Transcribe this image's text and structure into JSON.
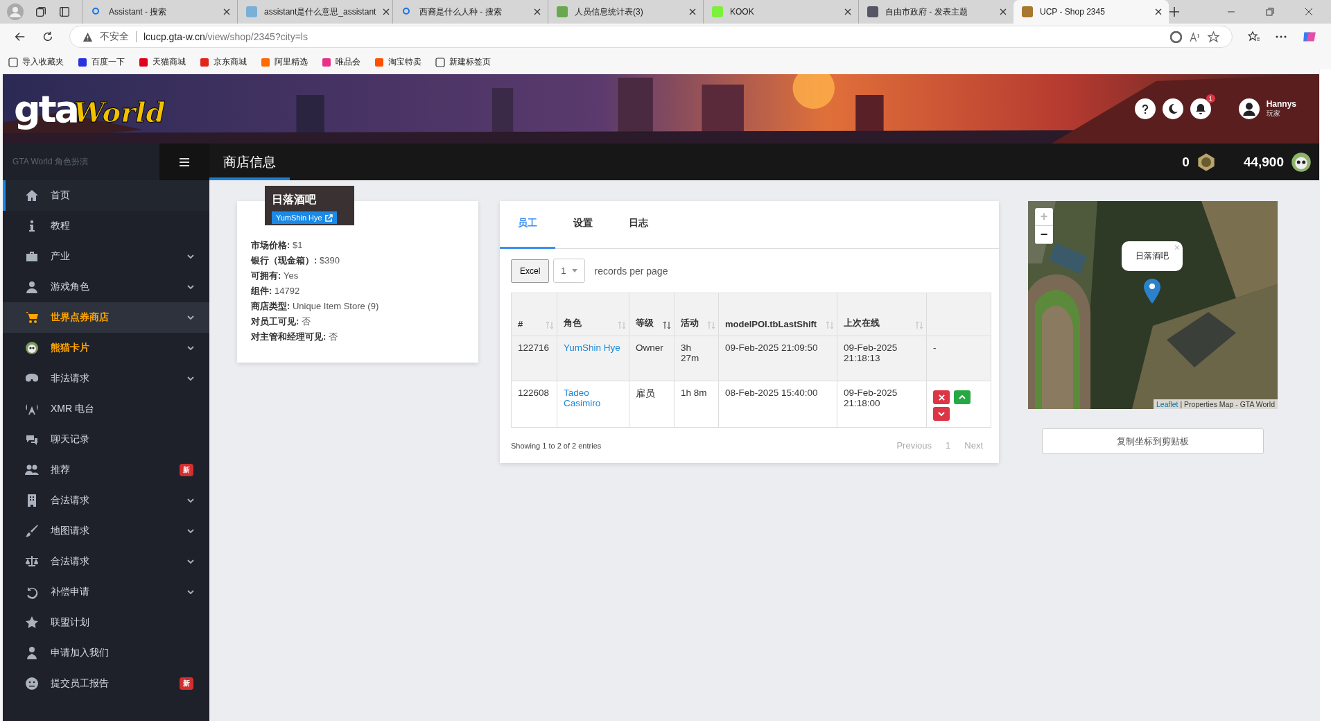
{
  "browser": {
    "tabs": [
      {
        "title": "Assistant - 搜索",
        "kind": "search",
        "selected": false
      },
      {
        "title": "assistant是什么意思_assistant",
        "selected": false
      },
      {
        "title": "西裔是什么人种 - 搜索",
        "kind": "search",
        "selected": false
      },
      {
        "title": "人员信息统计表(3)",
        "kind": "sheet",
        "selected": false
      },
      {
        "title": "KOOK",
        "kind": "kook",
        "selected": false
      },
      {
        "title": "自由市政府 - 发表主题",
        "kind": "seal",
        "selected": false
      },
      {
        "title": "UCP - Shop 2345",
        "kind": "shop",
        "selected": true
      }
    ],
    "address": {
      "warning": "不安全",
      "host": "lcucp.gta-w.cn",
      "path": "/view/shop/2345?city=ls"
    },
    "bookmarks": [
      {
        "label": "导入收藏夹",
        "kind": "import"
      },
      {
        "label": "百度一下",
        "kind": "paw"
      },
      {
        "label": "天猫商城",
        "kind": "tmall"
      },
      {
        "label": "京东商城",
        "kind": "jd"
      },
      {
        "label": "阿里精选",
        "kind": "ali"
      },
      {
        "label": "唯品会",
        "kind": "vip"
      },
      {
        "label": "淘宝特卖",
        "kind": "taobao"
      },
      {
        "label": "新建标签页",
        "kind": "newtab"
      }
    ]
  },
  "header": {
    "logo_main": "gta",
    "logo_script": "World",
    "notifications": "1",
    "user": {
      "name": "Hannys",
      "role": "玩家"
    }
  },
  "nav": {
    "brand": "GTA World 角色扮演",
    "title": "商店信息",
    "coins": "0",
    "balance": "44,900"
  },
  "sidebar": {
    "items": [
      {
        "label": "首页",
        "kind": "home",
        "selected": true,
        "highlighted": false,
        "accent": false,
        "expandable": false
      },
      {
        "label": "教程",
        "kind": "info",
        "selected": false,
        "highlighted": false,
        "accent": false,
        "expandable": false
      },
      {
        "label": "产业",
        "kind": "briefcase",
        "selected": false,
        "highlighted": false,
        "accent": false,
        "expandable": true
      },
      {
        "label": "游戏角色",
        "kind": "user",
        "selected": false,
        "highlighted": false,
        "accent": false,
        "expandable": true
      },
      {
        "label": "世界点券商店",
        "kind": "cart",
        "selected": false,
        "highlighted": true,
        "accent": true,
        "expandable": true
      },
      {
        "label": "熊猫卡片",
        "kind": "panda",
        "selected": false,
        "highlighted": false,
        "accent": true,
        "expandable": true
      },
      {
        "label": "非法请求",
        "kind": "mask",
        "selected": false,
        "highlighted": false,
        "accent": false,
        "expandable": true
      },
      {
        "label": "XMR 电台",
        "kind": "radio",
        "selected": false,
        "highlighted": false,
        "accent": false,
        "expandable": false
      },
      {
        "label": "聊天记录",
        "kind": "chat",
        "selected": false,
        "highlighted": false,
        "accent": false,
        "expandable": false
      },
      {
        "label": "推荐",
        "kind": "users",
        "selected": false,
        "highlighted": false,
        "accent": false,
        "expandable": false,
        "badge": "新"
      },
      {
        "label": "合法请求",
        "kind": "building",
        "selected": false,
        "highlighted": false,
        "accent": false,
        "expandable": true
      },
      {
        "label": "地图请求",
        "kind": "brush",
        "selected": false,
        "highlighted": false,
        "accent": false,
        "expandable": true
      },
      {
        "label": "合法请求",
        "kind": "scale",
        "selected": false,
        "highlighted": false,
        "accent": false,
        "expandable": true
      },
      {
        "label": "补偿申请",
        "kind": "undo",
        "selected": false,
        "highlighted": false,
        "accent": false,
        "expandable": true
      },
      {
        "label": "联盟计划",
        "kind": "star",
        "selected": false,
        "highlighted": false,
        "accent": false,
        "expandable": false
      },
      {
        "label": "申请加入我们",
        "kind": "tie",
        "selected": false,
        "highlighted": false,
        "accent": false,
        "expandable": false
      },
      {
        "label": "提交员工报告",
        "kind": "face",
        "selected": false,
        "highlighted": false,
        "accent": false,
        "expandable": false,
        "badge": "新"
      }
    ]
  },
  "shop": {
    "name": "日落酒吧",
    "owner": "YumShin Hye",
    "facts": [
      {
        "label": "市场价格:",
        "value": "$1"
      },
      {
        "label": "银行（现金箱）:",
        "value": "$390"
      },
      {
        "label": "可拥有:",
        "value": "Yes"
      },
      {
        "label": "组件:",
        "value": "14792"
      },
      {
        "label": "商店类型:",
        "value": "Unique Item Store (9)"
      },
      {
        "label": "对员工可见:",
        "value": "否"
      },
      {
        "label": "对主管和经理可见:",
        "value": "否"
      }
    ]
  },
  "tabs": [
    {
      "label": "员工",
      "selected": true
    },
    {
      "label": "设置",
      "selected": false
    },
    {
      "label": "日志",
      "selected": false
    }
  ],
  "toolbar": {
    "export": "Excel",
    "page_size": "1",
    "page_size_label": "records per page"
  },
  "table": {
    "columns": [
      {
        "label": "#",
        "sorted": false
      },
      {
        "label": "角色",
        "sorted": false
      },
      {
        "label": "等级",
        "sorted": true
      },
      {
        "label": "活动",
        "sorted": false
      },
      {
        "label": "modelPOI.tbLastShift",
        "sorted": false
      },
      {
        "label": "上次在线",
        "sorted": false
      }
    ],
    "rows": [
      {
        "id": "122716",
        "character": "YumShin Hye",
        "rank": "Owner",
        "activity": "3h 27m",
        "last_shift": "09-Feb-2025 21:09:50",
        "last_online": "09-Feb-2025 21:18:13",
        "actions_text": "-"
      },
      {
        "id": "122608",
        "character": "Tadeo Casimiro",
        "rank": "雇员",
        "activity": "1h 8m",
        "last_shift": "08-Feb-2025 15:40:00",
        "last_online": "09-Feb-2025 21:18:00",
        "actions": [
          {
            "kind": "remove"
          },
          {
            "kind": "promote"
          },
          {
            "kind": "demote"
          }
        ]
      }
    ],
    "info": "Showing 1 to 2 of 2 entries",
    "pagination": [
      {
        "label": "Previous",
        "disabled": true
      },
      {
        "label": "1",
        "disabled": true
      },
      {
        "label": "Next",
        "disabled": true
      }
    ]
  },
  "map": {
    "zoom_in": "+",
    "zoom_out": "−",
    "popup": "日落酒吧",
    "popup_close": "×",
    "attribution_link": "Leaflet",
    "attribution": "| Properties Map - GTA World"
  },
  "copy_button": "复制坐标到剪贴板"
}
